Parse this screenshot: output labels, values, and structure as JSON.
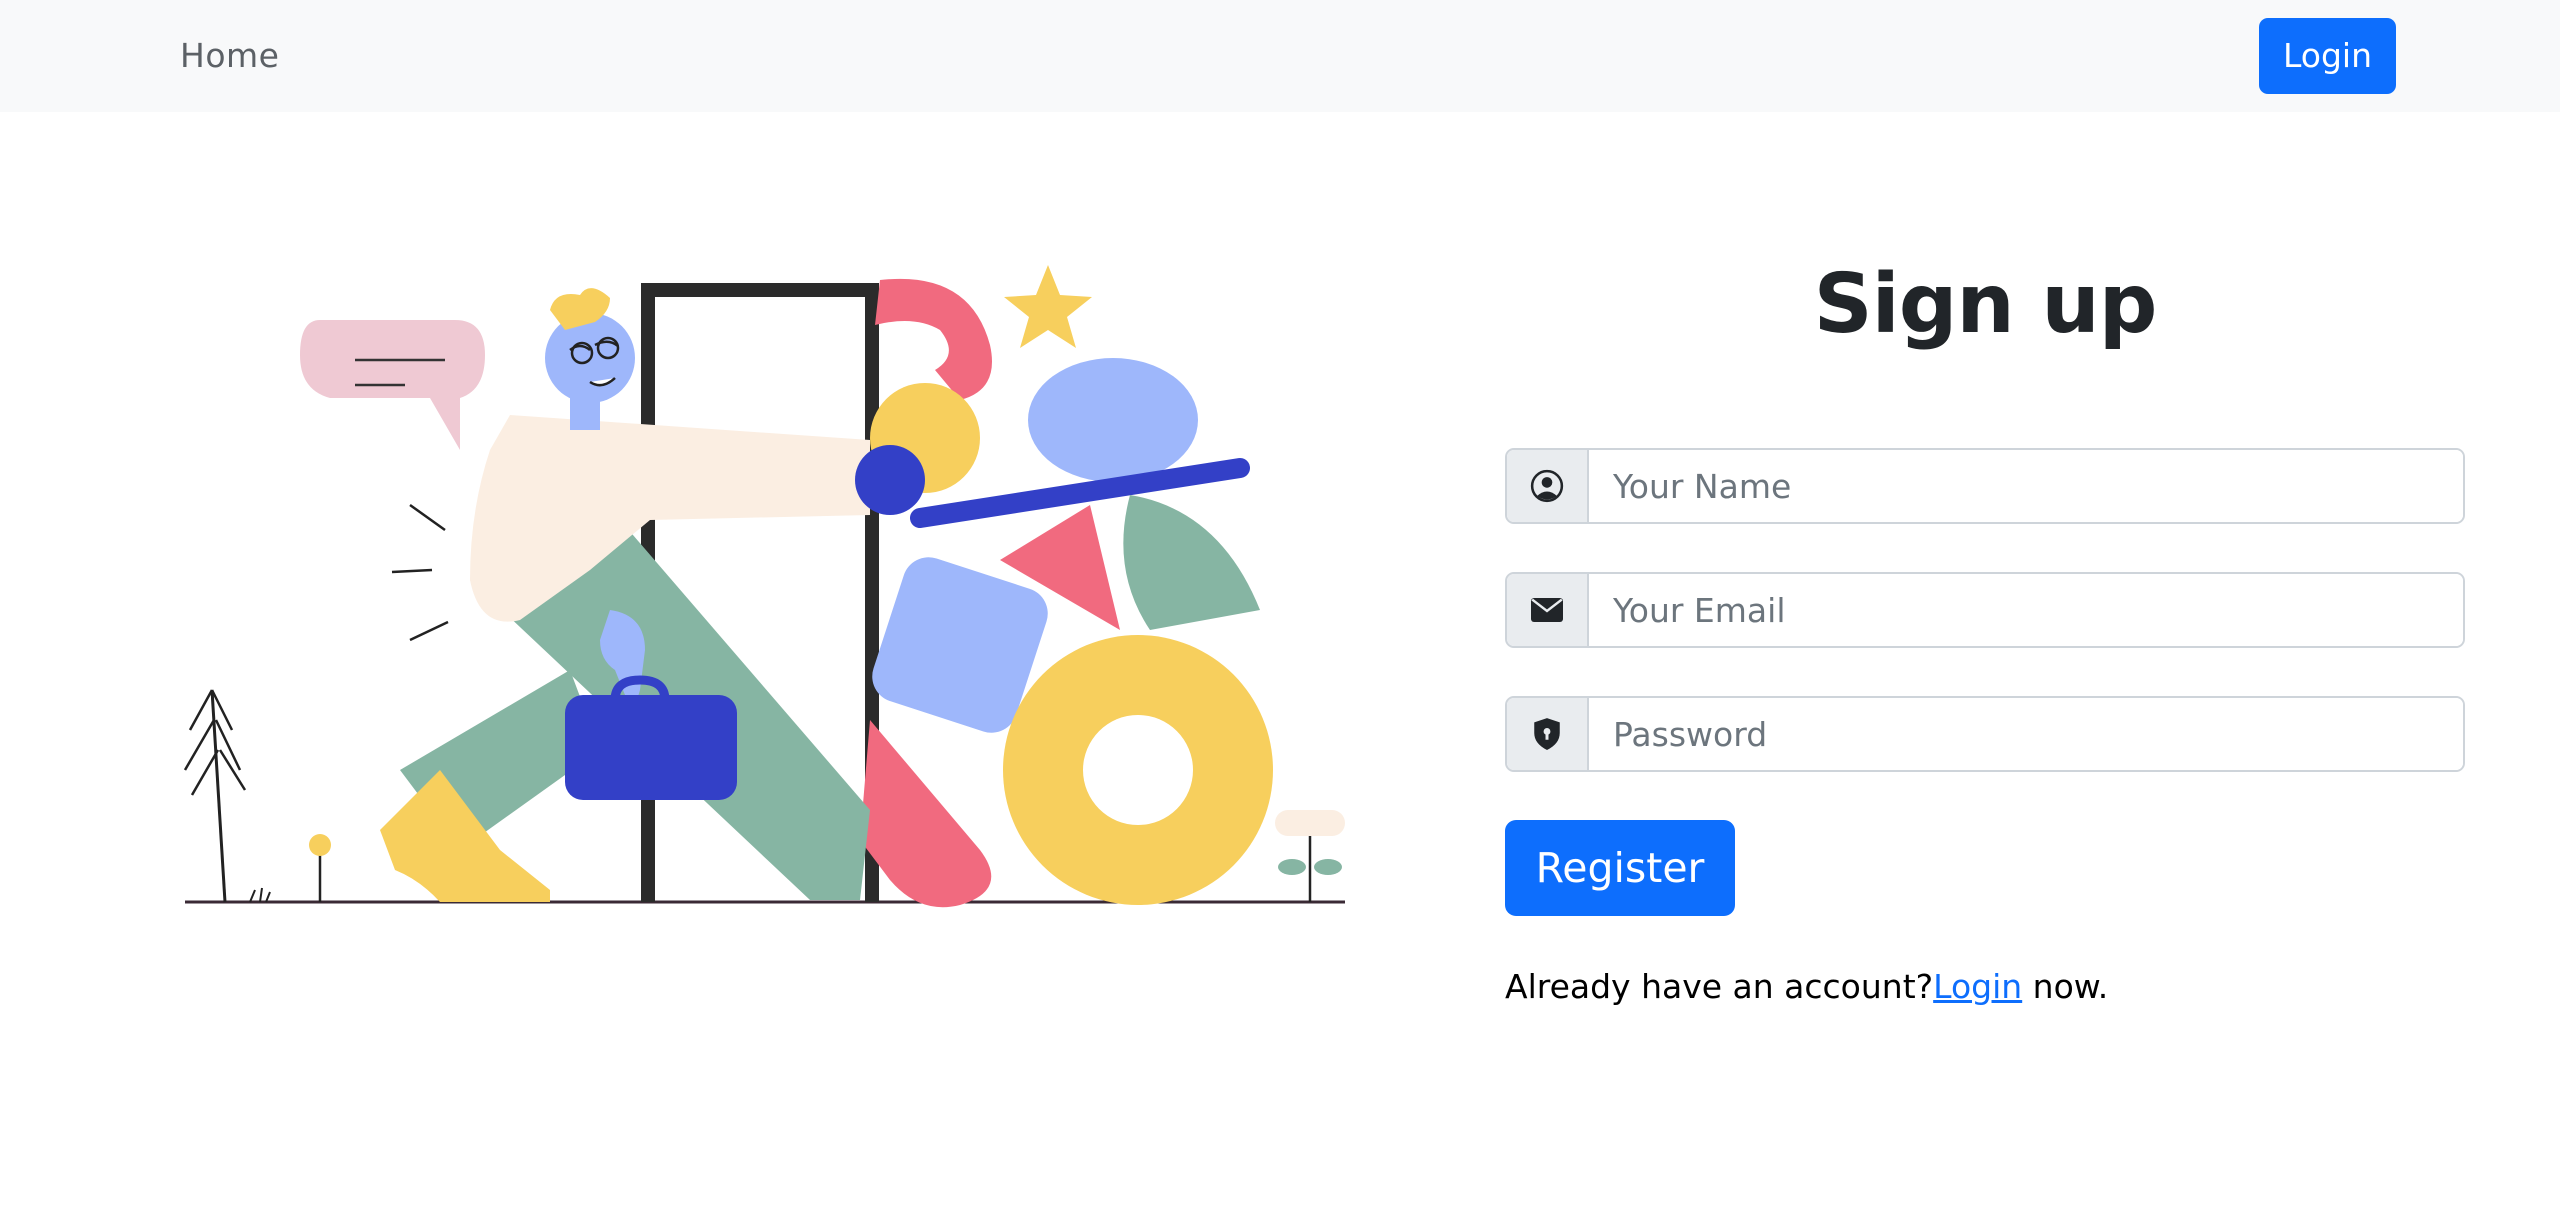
{
  "nav": {
    "home_label": "Home",
    "login_label": "Login"
  },
  "form": {
    "title": "Sign up",
    "name": {
      "placeholder": "Your Name",
      "icon": "person-circle-icon"
    },
    "email": {
      "placeholder": "Your Email",
      "icon": "envelope-icon"
    },
    "password": {
      "placeholder": "Password",
      "icon": "shield-lock-icon"
    },
    "register_label": "Register",
    "already_prefix": "Already have an account?",
    "login_link_label": "Login",
    "already_suffix": " now."
  },
  "colors": {
    "primary": "#0d6efd",
    "navbar_bg": "#f8f9fa",
    "addon_bg": "#e9ecef"
  }
}
